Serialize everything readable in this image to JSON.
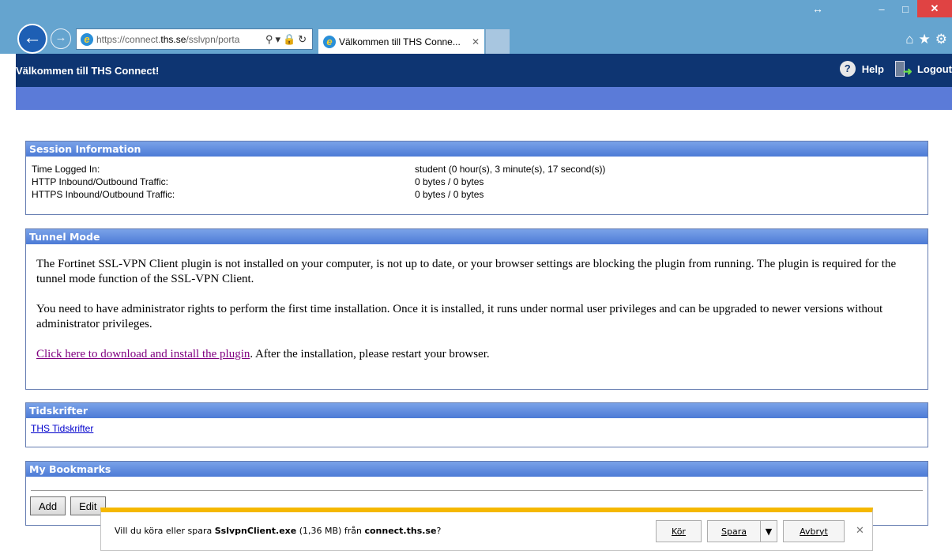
{
  "browser": {
    "address_prefix": "https://connect.",
    "address_domain": "ths.se",
    "address_suffix": "/sslvpn/porta",
    "tab_title": "Välkommen till THS Conne...",
    "window_controls": [
      "minimize",
      "maximize",
      "close"
    ]
  },
  "header": {
    "title": "Välkommen till THS Connect!",
    "help": "Help",
    "logout": "Logout"
  },
  "session": {
    "title": "Session Information",
    "rows": [
      {
        "label": "Time Logged In:",
        "value": "student (0 hour(s), 3 minute(s), 17 second(s))"
      },
      {
        "label": "HTTP Inbound/Outbound Traffic:",
        "value": "0 bytes / 0 bytes"
      },
      {
        "label": "HTTPS Inbound/Outbound Traffic:",
        "value": "0 bytes / 0 bytes"
      }
    ]
  },
  "tunnel": {
    "title": "Tunnel Mode",
    "p1": "The Fortinet SSL-VPN Client plugin is not installed on your computer, is not up to date, or your browser settings are blocking the plugin from running. The plugin is required for the tunnel mode function of the SSL-VPN Client.",
    "p2": "You need to have administrator rights to perform the first time installation. Once it is installed, it runs under normal user privileges and can be upgraded to newer versions without administrator privileges.",
    "link": "Click here to download and install the plugin",
    "after_link": ". After the installation, please restart your browser."
  },
  "tidskrifter": {
    "title": "Tidskrifter",
    "link": "THS Tidskrifter"
  },
  "bookmarks": {
    "title": "My Bookmarks",
    "add": "Add",
    "edit": "Edit"
  },
  "download": {
    "prefix": "Vill du köra eller spara ",
    "file": "SslvpnClient.exe",
    "size": " (1,36 MB) från ",
    "host": "connect.ths.se",
    "suffix": "?",
    "run": "Kör",
    "save": "Spara",
    "cancel": "Avbryt"
  }
}
